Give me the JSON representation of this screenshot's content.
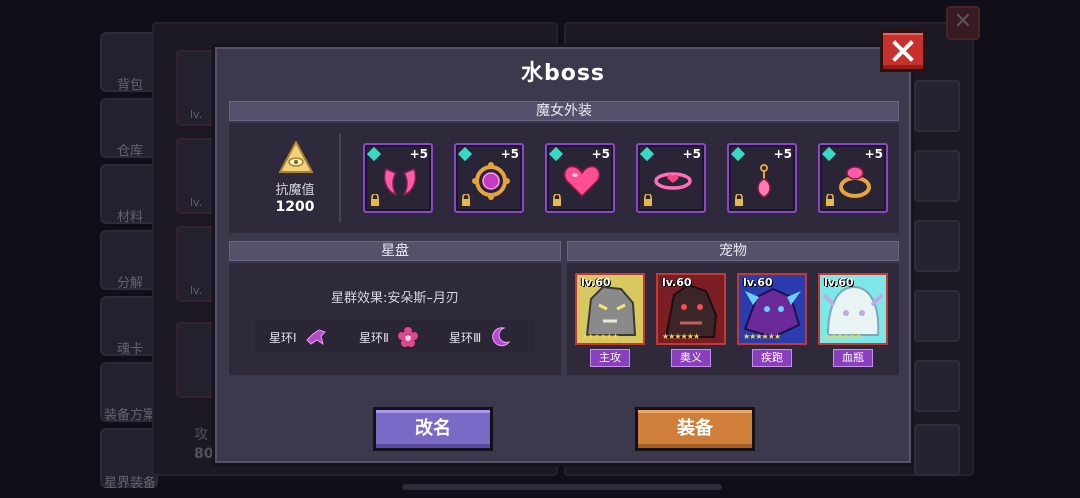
{
  "background": {
    "sidebar_items": [
      "背包",
      "仓库",
      "材料",
      "分解",
      "魂卡",
      "装备方案",
      "星界装备"
    ],
    "slot_level_label": "lv.",
    "attack_label": "攻",
    "attack_value_partial": "80"
  },
  "dialog": {
    "title": "水boss",
    "close_icon": "close-x-icon",
    "witch_outfit": {
      "header": "魔女外装",
      "resistance": {
        "icon": "eye-pyramid-icon",
        "label": "抗魔值",
        "value": "1200"
      },
      "items": [
        {
          "name": "horns",
          "icon": "horns-icon",
          "plus": "+5",
          "color": "#ff5aa8"
        },
        {
          "name": "orb-amulet",
          "icon": "orb-icon",
          "plus": "+5",
          "color": "#e8a33a"
        },
        {
          "name": "heart",
          "icon": "heart-icon",
          "plus": "+5",
          "color": "#ff4f92"
        },
        {
          "name": "necklace",
          "icon": "necklace-icon",
          "plus": "+5",
          "color": "#ff6fb5"
        },
        {
          "name": "earring",
          "icon": "earring-icon",
          "plus": "+5",
          "color": "#ff7ab0"
        },
        {
          "name": "ring",
          "icon": "ring-icon",
          "plus": "+5",
          "color": "#e8a33a"
        }
      ]
    },
    "star_disk": {
      "header": "星盘",
      "effect_text": "星群效果:安朵斯–月刃",
      "rings": [
        {
          "label": "星环Ⅰ",
          "icon": "crow-icon",
          "color": "#b04ac8"
        },
        {
          "label": "星环Ⅱ",
          "icon": "flower-icon",
          "color": "#e2468e"
        },
        {
          "label": "星环Ⅲ",
          "icon": "crescent-moon-icon",
          "color": "#b84ad0"
        }
      ]
    },
    "pets": {
      "header": "宠物",
      "items": [
        {
          "level": "lv.60",
          "tag": "主攻",
          "stars": "★★★★★★",
          "palette": [
            "#d8c860",
            "#8a8a8a",
            "#ece8d8"
          ]
        },
        {
          "level": "lv.60",
          "tag": "奥义",
          "stars": "★★★★★★",
          "palette": [
            "#7a1e24",
            "#3a2626",
            "#c06060"
          ]
        },
        {
          "level": "lv.60",
          "tag": "疾跑",
          "stars": "★★★★★★",
          "palette": [
            "#2a3cae",
            "#6a2a9a",
            "#6ad0ff"
          ]
        },
        {
          "level": "lv.60",
          "tag": "血瓶",
          "stars": "★★★★★★",
          "palette": [
            "#7ee8e8",
            "#e8f4f4",
            "#c0a8e0"
          ]
        }
      ]
    },
    "buttons": {
      "rename": "改名",
      "equip": "装备"
    }
  },
  "colors": {
    "dialog_bg": "#3d394c",
    "section_bar": "#56516a",
    "equip_border": "#8c47c9",
    "pet_border": "#c43933",
    "pet_tag": "#8a3fbd",
    "rename_button": "#7a6ac6",
    "equip_button": "#d07f3a",
    "close_button": "#c7302d"
  }
}
